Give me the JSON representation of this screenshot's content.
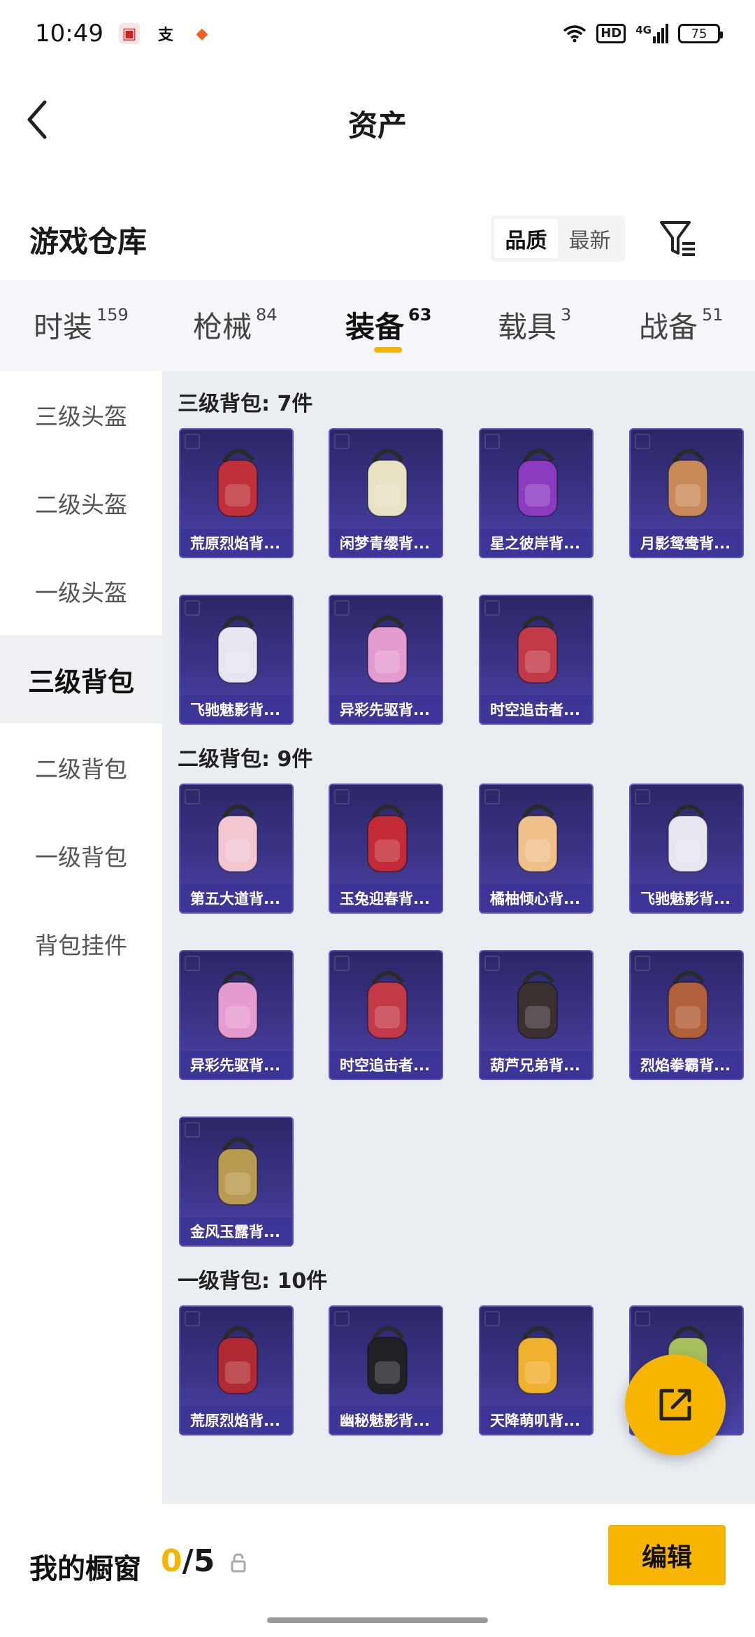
{
  "status_bar": {
    "time": "10:49",
    "network": "4G",
    "hd": "HD",
    "battery": "75"
  },
  "header": {
    "title": "资产"
  },
  "warehouse": {
    "title": "游戏仓库",
    "sort_options": [
      "品质",
      "最新"
    ],
    "sort_selected": "品质"
  },
  "tabs": [
    {
      "label": "时装",
      "count": "159"
    },
    {
      "label": "枪械",
      "count": "84"
    },
    {
      "label": "装备",
      "count": "63"
    },
    {
      "label": "载具",
      "count": "3"
    },
    {
      "label": "战备",
      "count": "51"
    }
  ],
  "active_tab": "装备",
  "sidebar": {
    "items": [
      "三级头盔",
      "二级头盔",
      "一级头盔",
      "三级背包",
      "二级背包",
      "一级背包",
      "背包挂件"
    ],
    "active": "三级背包"
  },
  "sections": [
    {
      "title": "三级背包: 7件",
      "items": [
        {
          "name": "荒原烈焰背...",
          "icon": "red-backpack",
          "color": "#c0303a"
        },
        {
          "name": "闲梦青缨背...",
          "icon": "white-backpack",
          "color": "#e8e2c4"
        },
        {
          "name": "星之彼岸背...",
          "icon": "space-backpack",
          "color": "#8a3bc0"
        },
        {
          "name": "月影鸳鸯背...",
          "icon": "bird-backpack",
          "color": "#c98a5a"
        },
        {
          "name": "飞驰魅影背...",
          "icon": "racer-backpack",
          "color": "#e8e5f0"
        },
        {
          "name": "异彩先驱背...",
          "icon": "bunny-backpack",
          "color": "#e49bd0"
        },
        {
          "name": "时空追击者...",
          "icon": "mech-backpack",
          "color": "#c23a48"
        }
      ]
    },
    {
      "title": "二级背包: 9件",
      "items": [
        {
          "name": "第五大道背...",
          "icon": "handbag-backpack",
          "color": "#f2c7d2"
        },
        {
          "name": "玉兔迎春背...",
          "icon": "rabbit-backpack",
          "color": "#c22a36"
        },
        {
          "name": "橘柚倾心背...",
          "icon": "cat-backpack",
          "color": "#f0c08a"
        },
        {
          "name": "飞驰魅影背...",
          "icon": "racer-backpack",
          "color": "#e8e5f0"
        },
        {
          "name": "异彩先驱背...",
          "icon": "bunny-backpack",
          "color": "#e49bd0"
        },
        {
          "name": "时空追击者...",
          "icon": "mech-backpack",
          "color": "#c23a48"
        },
        {
          "name": "葫芦兄弟背...",
          "icon": "gourd-backpack",
          "color": "#3a3030"
        },
        {
          "name": "烈焰拳霸背...",
          "icon": "fist-backpack",
          "color": "#b0603a"
        },
        {
          "name": "金风玉露背...",
          "icon": "gold-backpack",
          "color": "#b89a50"
        }
      ]
    },
    {
      "title": "一级背包: 10件",
      "items": [
        {
          "name": "荒原烈焰背...",
          "icon": "red-backpack",
          "color": "#b02a34"
        },
        {
          "name": "幽秘魅影背...",
          "icon": "black-backpack",
          "color": "#222226"
        },
        {
          "name": "天降萌叽背...",
          "icon": "chick-backpack",
          "color": "#f0b030"
        },
        {
          "name": "",
          "icon": "green-backpack",
          "color": "#a8c060"
        }
      ]
    }
  ],
  "bottom_bar": {
    "label": "我的橱窗",
    "current": "0",
    "separator": "/",
    "max": "5",
    "edit_label": "编辑"
  },
  "colors": {
    "accent": "#f7b500",
    "card_bg": "#3b3488",
    "content_bg": "#eaedf2"
  }
}
